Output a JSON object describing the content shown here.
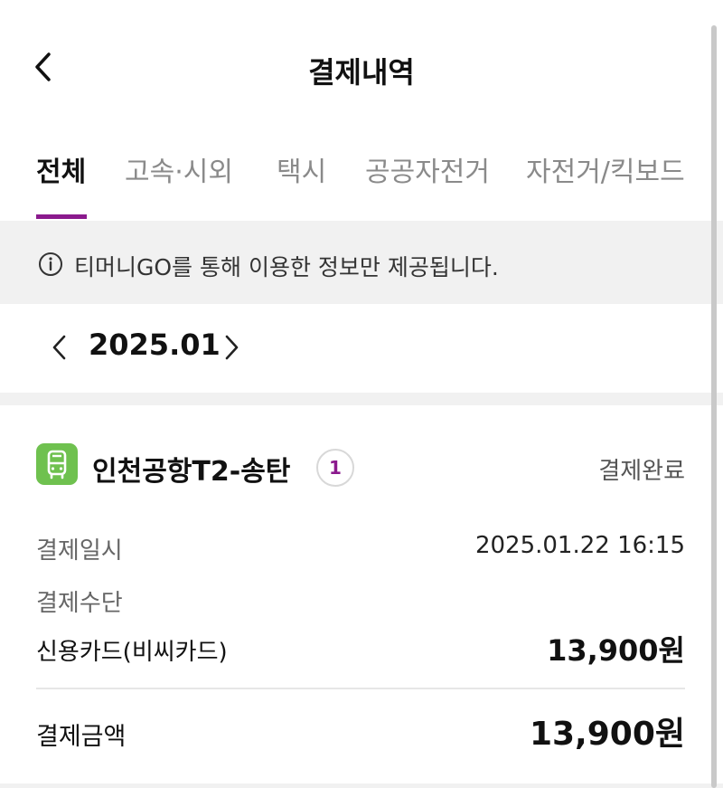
{
  "header": {
    "title": "결제내역",
    "back_icon": "chevron-left-icon"
  },
  "tabs": [
    {
      "label": "전체",
      "active": true
    },
    {
      "label": "고속·시외",
      "active": false
    },
    {
      "label": "택시",
      "active": false
    },
    {
      "label": "공공자전거",
      "active": false
    },
    {
      "label": "자전거/킥보드",
      "active": false
    }
  ],
  "notice": {
    "icon": "info-icon",
    "text": "티머니GO를 통해 이용한 정보만 제공됩니다."
  },
  "month": {
    "label": "2025.01",
    "prev_icon": "chevron-left-icon",
    "next_icon": "chevron-right-icon"
  },
  "card": {
    "route_icon": "bus-icon",
    "route_name": "인천공항T2-송탄",
    "count": "1",
    "status": "결제완료",
    "date_label": "결제일시",
    "date_value": "2025.01.22 16:15",
    "method_label": "결제수단",
    "method_name": "신용카드(비씨카드)",
    "method_amount": "13,900원",
    "total_label": "결제금액",
    "total_amount": "13,900원"
  },
  "colors": {
    "accent": "#8b1a8d",
    "route_icon_bg": "#6fc14f",
    "band": "#f1f1f1"
  }
}
